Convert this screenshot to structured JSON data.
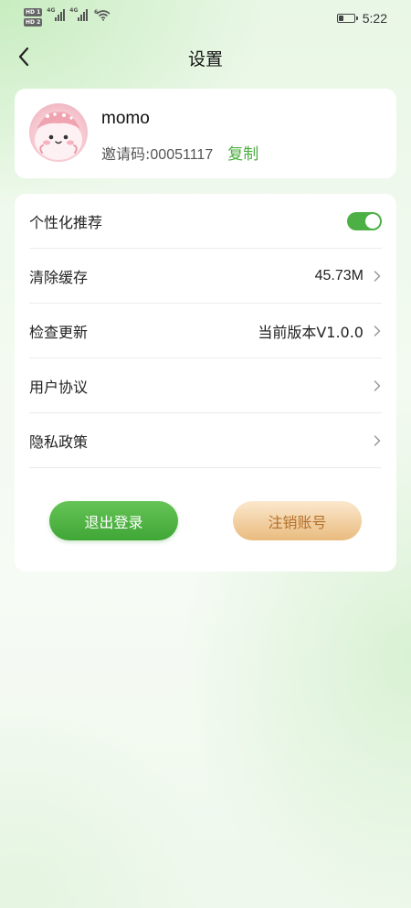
{
  "status_bar": {
    "sim1_badge": "HD 1",
    "sim2_badge": "HD 2",
    "network_type_1": "4G",
    "network_type_2": "4G",
    "wifi_badge": "6",
    "battery_level_percent": 30,
    "time": "5:22"
  },
  "header": {
    "title": "设置",
    "back_icon": "chevron-left-icon"
  },
  "profile": {
    "username": "momo",
    "invite_label": "邀请码:",
    "invite_code": "00051117",
    "copy_label": "复制",
    "avatar_icon": "cartoon-avatar"
  },
  "settings": {
    "personalized": {
      "label": "个性化推荐",
      "enabled": true
    },
    "clear_cache": {
      "label": "清除缓存",
      "value": "45.73M"
    },
    "check_update": {
      "label": "检查更新",
      "value": "当前版本V1.0.0"
    },
    "user_agreement": {
      "label": "用户协议"
    },
    "privacy_policy": {
      "label": "隐私政策"
    }
  },
  "actions": {
    "logout_label": "退出登录",
    "cancel_account_label": "注销账号"
  },
  "colors": {
    "accent_green": "#4cb044",
    "cancel_text": "#b4702b",
    "cancel_bg": "#e9bb7e"
  }
}
